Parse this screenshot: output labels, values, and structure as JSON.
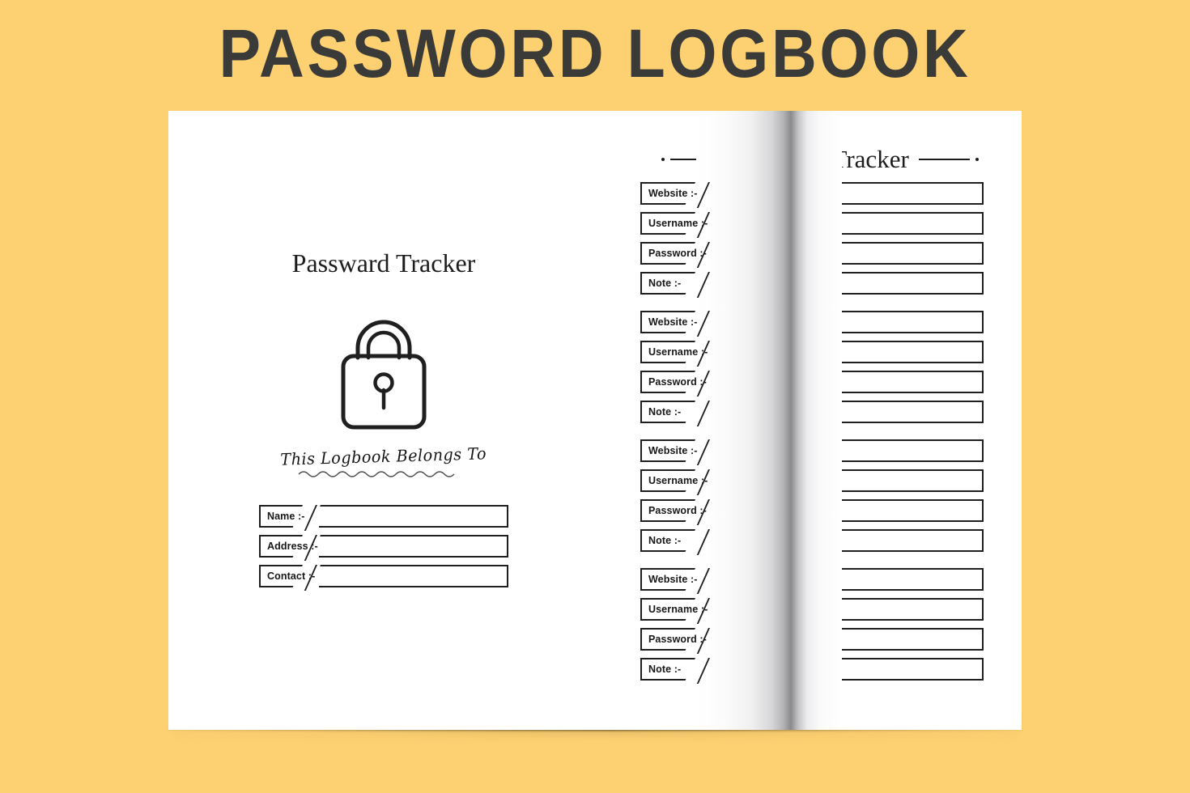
{
  "title": "PASSWORD LOGBOOK",
  "colors": {
    "background": "#fdd072",
    "ink": "#1f1f1f",
    "title_ink": "#3a3a38",
    "page": "#ffffff"
  },
  "left_page": {
    "heading": "Passward Tracker",
    "lock_icon": "lock-icon",
    "belongs_to": "This Logbook Belongs To",
    "fields": [
      {
        "label": "Name :-",
        "value": ""
      },
      {
        "label": "Address :-",
        "value": ""
      },
      {
        "label": "Contact :-",
        "value": ""
      }
    ]
  },
  "right_page": {
    "heading": "Passward Tracker",
    "ornament_left": "dash-dot-ornament",
    "ornament_right": "dash-dot-ornament",
    "entry_labels": [
      "Website :-",
      "Username :-",
      "Password :-",
      "Note :-"
    ],
    "entries": [
      {
        "website": "",
        "username": "",
        "password": "",
        "note": ""
      },
      {
        "website": "",
        "username": "",
        "password": "",
        "note": ""
      },
      {
        "website": "",
        "username": "",
        "password": "",
        "note": ""
      },
      {
        "website": "",
        "username": "",
        "password": "",
        "note": ""
      }
    ]
  }
}
